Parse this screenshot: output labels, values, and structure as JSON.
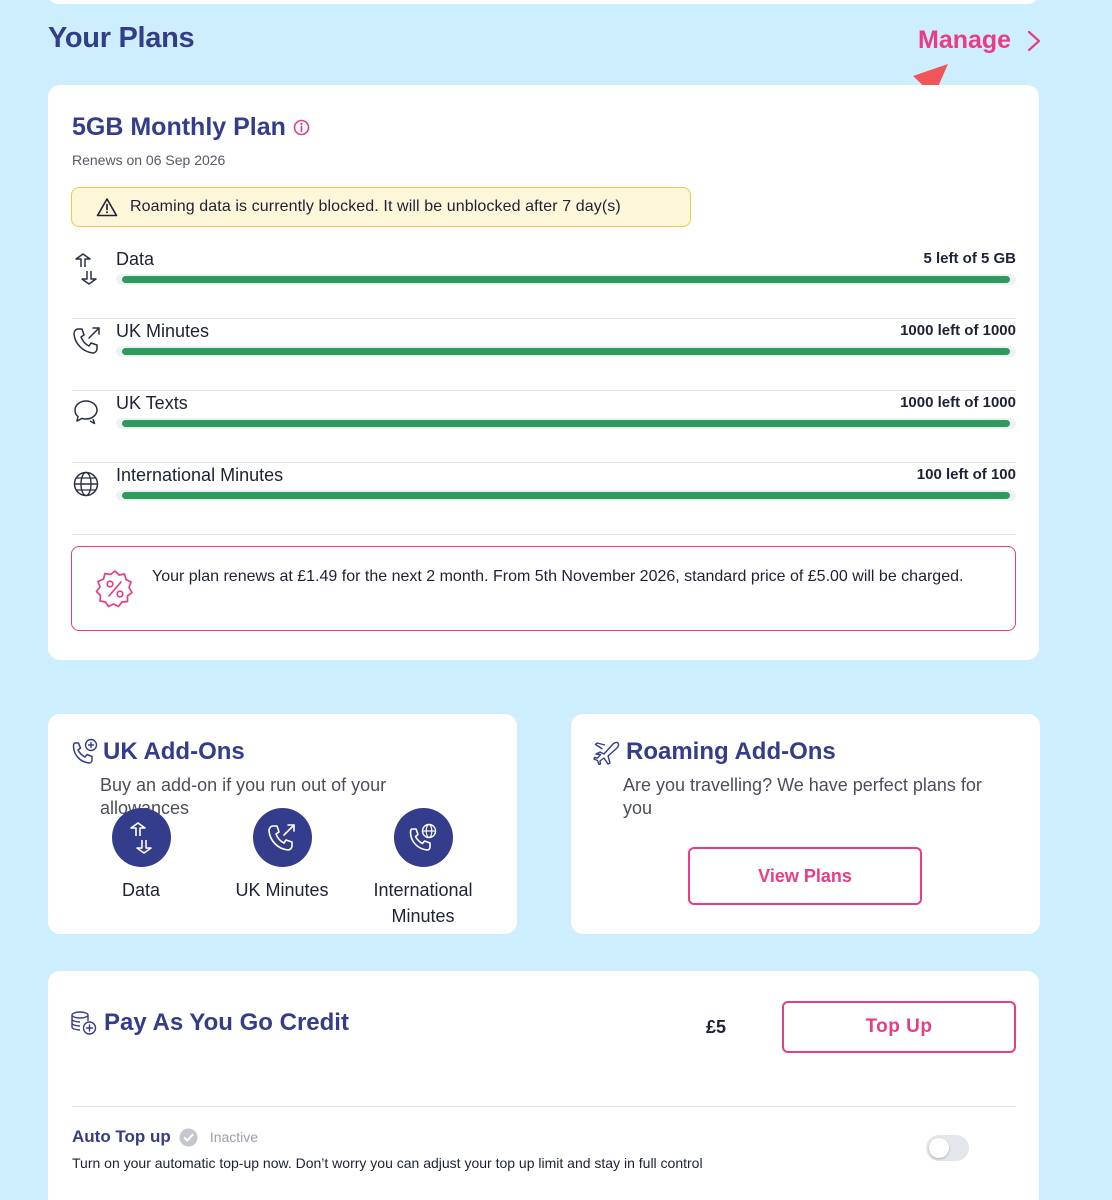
{
  "header": {
    "title": "Your Plans",
    "manage_label": "Manage"
  },
  "plan": {
    "name": "5GB Monthly Plan",
    "renews": "Renews on 06 Sep 2026",
    "roaming_alert": "Roaming data is currently blocked. It will be unblocked after 7 day(s)",
    "usage": [
      {
        "icon": "data-arrows-icon",
        "label": "Data",
        "amount": "5 left of 5 GB",
        "remaining_fraction": 1.0
      },
      {
        "icon": "phone-outgoing-icon",
        "label": "UK Minutes",
        "amount": "1000 left of 1000",
        "remaining_fraction": 1.0
      },
      {
        "icon": "chat-bubbles-icon",
        "label": "UK Texts",
        "amount": "1000 left of 1000",
        "remaining_fraction": 1.0
      },
      {
        "icon": "globe-icon",
        "label": "International Minutes",
        "amount": "100 left of 100",
        "remaining_fraction": 1.0
      }
    ],
    "promo_text": "Your plan renews at £1.49 for the next 2 month. From 5th November 2026, standard price of £5.00 will be charged."
  },
  "uk_addons": {
    "title": "UK Add-Ons",
    "subtitle": "Buy an add-on if you run out of your allowances",
    "items": [
      {
        "icon": "data-arrows-icon",
        "label": "Data"
      },
      {
        "icon": "phone-outgoing-icon",
        "label": "UK Minutes"
      },
      {
        "icon": "phone-globe-icon",
        "label": "International Minutes"
      }
    ]
  },
  "roaming_addons": {
    "title": "Roaming Add-Ons",
    "subtitle": "Are you travelling? We have perfect plans for you",
    "button_label": "View Plans"
  },
  "payg": {
    "title": "Pay As You Go Credit",
    "balance": "£5",
    "topup_label": "Top Up",
    "auto_topup_label": "Auto Top up",
    "auto_topup_status": "Inactive",
    "auto_topup_description": "Turn on your automatic top-up now. Don’t worry you can adjust your top up limit and stay in full control",
    "auto_topup_enabled": false
  },
  "colors": {
    "background": "#cdeefc",
    "brand_navy": "#343d8c",
    "accent_pink": "#ea3c84",
    "progress_green": "#2e9a5b",
    "warning_bg": "#fdf6d8",
    "warning_border": "#efc84e"
  }
}
